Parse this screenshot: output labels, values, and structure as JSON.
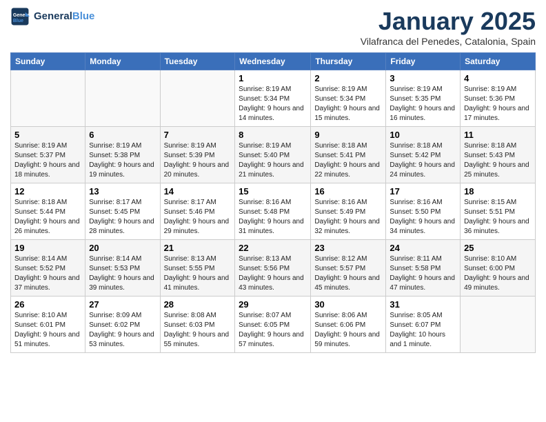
{
  "header": {
    "logo_line1": "General",
    "logo_line2": "Blue",
    "month_title": "January 2025",
    "location": "Vilafranca del Penedes, Catalonia, Spain"
  },
  "weekdays": [
    "Sunday",
    "Monday",
    "Tuesday",
    "Wednesday",
    "Thursday",
    "Friday",
    "Saturday"
  ],
  "weeks": [
    [
      {
        "num": "",
        "info": ""
      },
      {
        "num": "",
        "info": ""
      },
      {
        "num": "",
        "info": ""
      },
      {
        "num": "1",
        "info": "Sunrise: 8:19 AM\nSunset: 5:34 PM\nDaylight: 9 hours and 14 minutes."
      },
      {
        "num": "2",
        "info": "Sunrise: 8:19 AM\nSunset: 5:34 PM\nDaylight: 9 hours and 15 minutes."
      },
      {
        "num": "3",
        "info": "Sunrise: 8:19 AM\nSunset: 5:35 PM\nDaylight: 9 hours and 16 minutes."
      },
      {
        "num": "4",
        "info": "Sunrise: 8:19 AM\nSunset: 5:36 PM\nDaylight: 9 hours and 17 minutes."
      }
    ],
    [
      {
        "num": "5",
        "info": "Sunrise: 8:19 AM\nSunset: 5:37 PM\nDaylight: 9 hours and 18 minutes."
      },
      {
        "num": "6",
        "info": "Sunrise: 8:19 AM\nSunset: 5:38 PM\nDaylight: 9 hours and 19 minutes."
      },
      {
        "num": "7",
        "info": "Sunrise: 8:19 AM\nSunset: 5:39 PM\nDaylight: 9 hours and 20 minutes."
      },
      {
        "num": "8",
        "info": "Sunrise: 8:19 AM\nSunset: 5:40 PM\nDaylight: 9 hours and 21 minutes."
      },
      {
        "num": "9",
        "info": "Sunrise: 8:18 AM\nSunset: 5:41 PM\nDaylight: 9 hours and 22 minutes."
      },
      {
        "num": "10",
        "info": "Sunrise: 8:18 AM\nSunset: 5:42 PM\nDaylight: 9 hours and 24 minutes."
      },
      {
        "num": "11",
        "info": "Sunrise: 8:18 AM\nSunset: 5:43 PM\nDaylight: 9 hours and 25 minutes."
      }
    ],
    [
      {
        "num": "12",
        "info": "Sunrise: 8:18 AM\nSunset: 5:44 PM\nDaylight: 9 hours and 26 minutes."
      },
      {
        "num": "13",
        "info": "Sunrise: 8:17 AM\nSunset: 5:45 PM\nDaylight: 9 hours and 28 minutes."
      },
      {
        "num": "14",
        "info": "Sunrise: 8:17 AM\nSunset: 5:46 PM\nDaylight: 9 hours and 29 minutes."
      },
      {
        "num": "15",
        "info": "Sunrise: 8:16 AM\nSunset: 5:48 PM\nDaylight: 9 hours and 31 minutes."
      },
      {
        "num": "16",
        "info": "Sunrise: 8:16 AM\nSunset: 5:49 PM\nDaylight: 9 hours and 32 minutes."
      },
      {
        "num": "17",
        "info": "Sunrise: 8:16 AM\nSunset: 5:50 PM\nDaylight: 9 hours and 34 minutes."
      },
      {
        "num": "18",
        "info": "Sunrise: 8:15 AM\nSunset: 5:51 PM\nDaylight: 9 hours and 36 minutes."
      }
    ],
    [
      {
        "num": "19",
        "info": "Sunrise: 8:14 AM\nSunset: 5:52 PM\nDaylight: 9 hours and 37 minutes."
      },
      {
        "num": "20",
        "info": "Sunrise: 8:14 AM\nSunset: 5:53 PM\nDaylight: 9 hours and 39 minutes."
      },
      {
        "num": "21",
        "info": "Sunrise: 8:13 AM\nSunset: 5:55 PM\nDaylight: 9 hours and 41 minutes."
      },
      {
        "num": "22",
        "info": "Sunrise: 8:13 AM\nSunset: 5:56 PM\nDaylight: 9 hours and 43 minutes."
      },
      {
        "num": "23",
        "info": "Sunrise: 8:12 AM\nSunset: 5:57 PM\nDaylight: 9 hours and 45 minutes."
      },
      {
        "num": "24",
        "info": "Sunrise: 8:11 AM\nSunset: 5:58 PM\nDaylight: 9 hours and 47 minutes."
      },
      {
        "num": "25",
        "info": "Sunrise: 8:10 AM\nSunset: 6:00 PM\nDaylight: 9 hours and 49 minutes."
      }
    ],
    [
      {
        "num": "26",
        "info": "Sunrise: 8:10 AM\nSunset: 6:01 PM\nDaylight: 9 hours and 51 minutes."
      },
      {
        "num": "27",
        "info": "Sunrise: 8:09 AM\nSunset: 6:02 PM\nDaylight: 9 hours and 53 minutes."
      },
      {
        "num": "28",
        "info": "Sunrise: 8:08 AM\nSunset: 6:03 PM\nDaylight: 9 hours and 55 minutes."
      },
      {
        "num": "29",
        "info": "Sunrise: 8:07 AM\nSunset: 6:05 PM\nDaylight: 9 hours and 57 minutes."
      },
      {
        "num": "30",
        "info": "Sunrise: 8:06 AM\nSunset: 6:06 PM\nDaylight: 9 hours and 59 minutes."
      },
      {
        "num": "31",
        "info": "Sunrise: 8:05 AM\nSunset: 6:07 PM\nDaylight: 10 hours and 1 minute."
      },
      {
        "num": "",
        "info": ""
      }
    ]
  ]
}
